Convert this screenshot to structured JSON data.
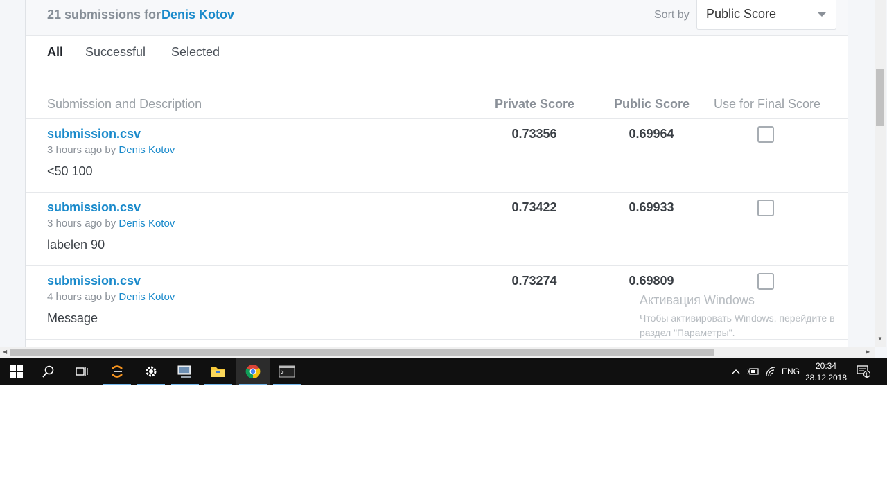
{
  "header": {
    "submissions_count": "21 submissions for",
    "user": "Denis Kotov",
    "sort_label": "Sort by",
    "sort_value": "Public Score"
  },
  "tabs": [
    "All",
    "Successful",
    "Selected"
  ],
  "columns": {
    "submission": "Submission and Description",
    "private": "Private Score",
    "public": "Public Score",
    "final": "Use for Final Score"
  },
  "rows": [
    {
      "file": "submission.csv",
      "time": "3 hours ago by",
      "user": "Denis Kotov",
      "desc": "<50 100",
      "private": "0.73356",
      "public": "0.69964"
    },
    {
      "file": "submission.csv",
      "time": "3 hours ago by",
      "user": "Denis Kotov",
      "desc": "labelen 90",
      "private": "0.73422",
      "public": "0.69933"
    },
    {
      "file": "submission.csv",
      "time": "4 hours ago by",
      "user": "Denis Kotov",
      "desc": "Message",
      "private": "0.73274",
      "public": "0.69809"
    }
  ],
  "watermark": {
    "title": "Активация Windows",
    "line1": "Чтобы активировать Windows, перейдите в",
    "line2": "раздел \"Параметры\"."
  },
  "taskbar": {
    "lang": "ENG",
    "time": "20:34",
    "date": "28.12.2018",
    "notifications": "1",
    "icons": [
      "windows-start-icon",
      "search-icon",
      "task-view-icon",
      "eclipse-icon",
      "settings-icon",
      "computer-icon",
      "file-explorer-icon",
      "chrome-icon",
      "terminal-icon"
    ]
  },
  "colors": {
    "link": "#1a8acb",
    "taskbar": "#101010"
  }
}
